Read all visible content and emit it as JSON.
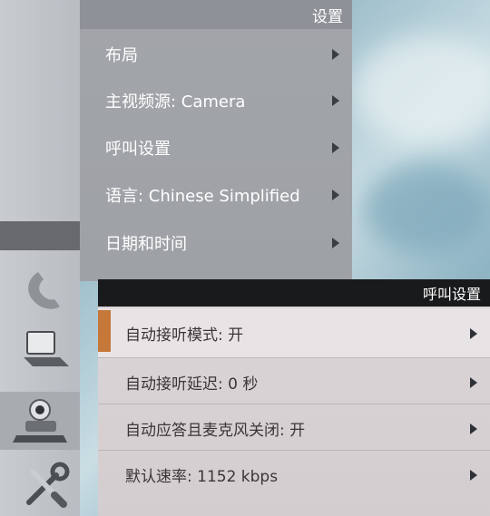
{
  "settings_menu": {
    "title": "设置",
    "items": [
      {
        "label": "布局"
      },
      {
        "label": "主视频源: Camera"
      },
      {
        "label": "呼叫设置"
      },
      {
        "label": "语言: Chinese Simplified"
      },
      {
        "label": "日期和时间"
      }
    ]
  },
  "call_settings_menu": {
    "title": "呼叫设置",
    "items": [
      {
        "label": "自动接听模式: 开",
        "selected": true
      },
      {
        "label": "自动接听延迟: 0 秒"
      },
      {
        "label": "自动应答且麦克风关闭: 开"
      },
      {
        "label": "默认速率: 1152 kbps"
      }
    ]
  },
  "sidebar_icons": [
    "phone-icon",
    "laptop-icon",
    "camera-icon",
    "tools-icon"
  ],
  "colors": {
    "accent": "#c57839",
    "title_bar_dark": "#191a1c",
    "menu1_bg": "#a2a5aa",
    "menu2_bg": "#dcd6d8"
  }
}
